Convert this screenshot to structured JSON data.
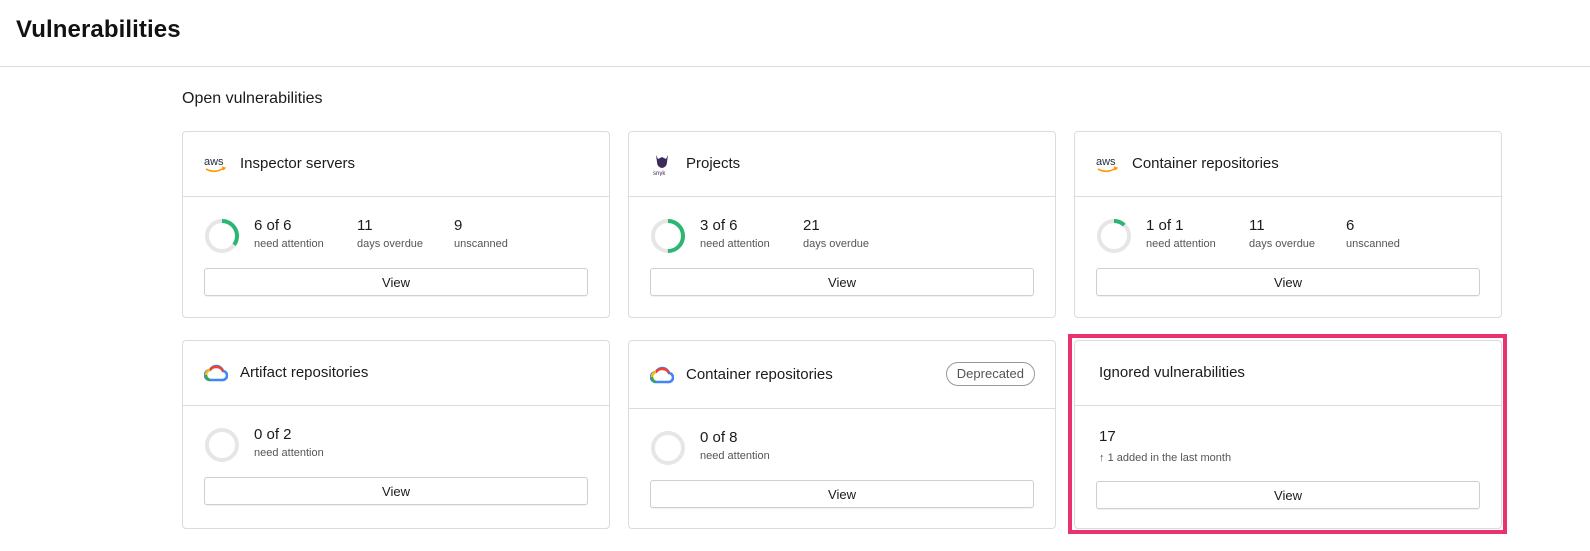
{
  "page": {
    "title": "Vulnerabilities"
  },
  "section": {
    "title": "Open vulnerabilities"
  },
  "cards": [
    {
      "title": "Inspector servers",
      "logo": "aws-logo",
      "logo_text": "aws",
      "ring_fraction": 0.35,
      "stats": [
        {
          "value": "6 of 6",
          "label": "need attention"
        },
        {
          "value": "11",
          "label": "days overdue"
        },
        {
          "value": "9",
          "label": "unscanned"
        }
      ],
      "button": "View"
    },
    {
      "title": "Projects",
      "logo": "snyk-logo",
      "logo_text": "snyk",
      "ring_fraction": 0.5,
      "stats": [
        {
          "value": "3 of 6",
          "label": "need attention"
        },
        {
          "value": "21",
          "label": "days overdue"
        }
      ],
      "button": "View"
    },
    {
      "title": "Container repositories",
      "logo": "aws-logo",
      "logo_text": "aws",
      "ring_fraction": 0.12,
      "stats": [
        {
          "value": "1 of 1",
          "label": "need attention"
        },
        {
          "value": "11",
          "label": "days overdue"
        },
        {
          "value": "6",
          "label": "unscanned"
        }
      ],
      "button": "View"
    },
    {
      "title": "Artifact repositories",
      "logo": "google-cloud-logo",
      "ring_fraction": 0,
      "stats": [
        {
          "value": "0 of 2",
          "label": "need attention"
        }
      ],
      "button": "View"
    },
    {
      "title": "Container repositories",
      "logo": "google-cloud-logo",
      "badge": "Deprecated",
      "ring_fraction": 0,
      "stats": [
        {
          "value": "0 of 8",
          "label": "need attention"
        }
      ],
      "button": "View"
    },
    {
      "title": "Ignored vulnerabilities",
      "count": "17",
      "sub": "1 added in the last month",
      "button": "View"
    }
  ],
  "colors": {
    "ring_fill": "#2bb673",
    "ring_track": "#e6e6e6",
    "highlight": "#e8336e",
    "aws_orange": "#f90"
  }
}
